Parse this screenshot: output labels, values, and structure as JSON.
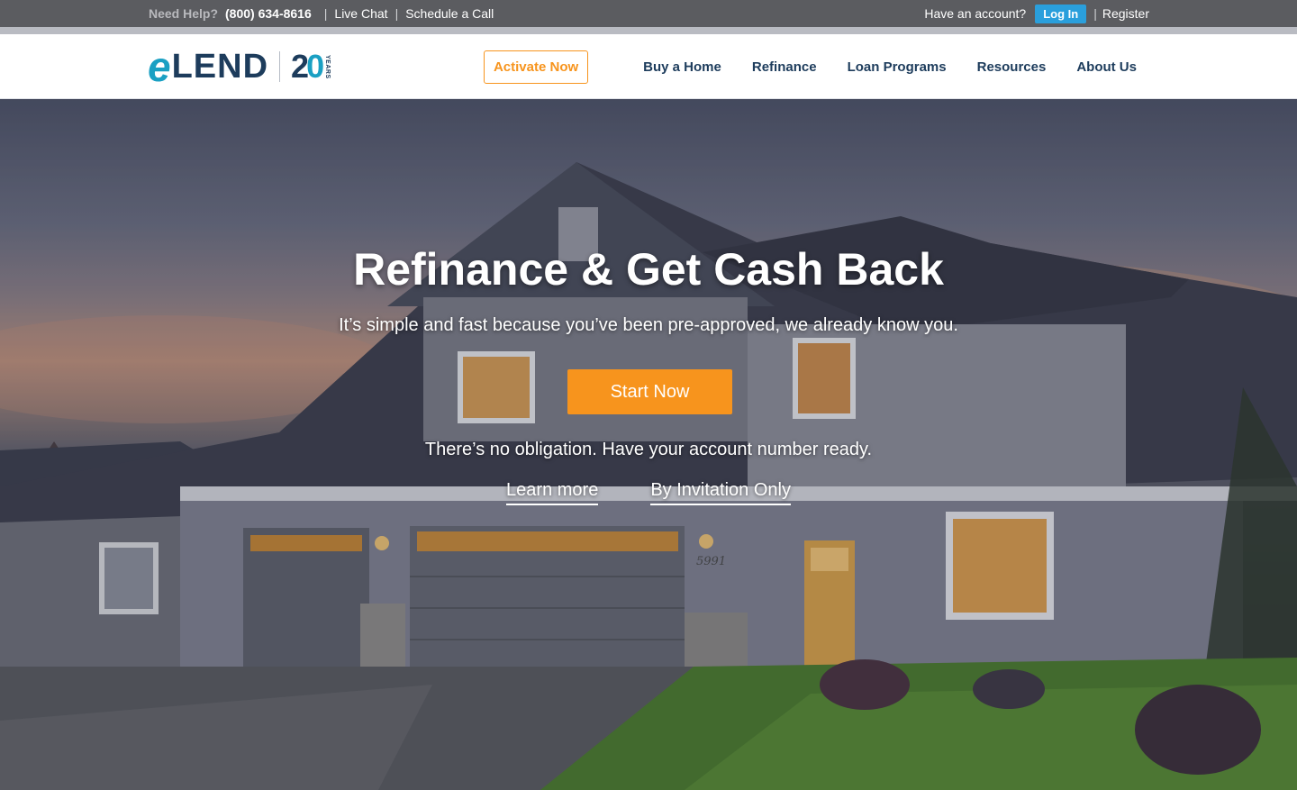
{
  "utility_bar": {
    "help_label": "Need Help?",
    "phone": "(800) 634-8616",
    "separator": "|",
    "live_chat": "Live Chat",
    "schedule_call": "Schedule a Call",
    "account_prompt": "Have an account?",
    "login_label": "Log In",
    "register_label": "Register"
  },
  "logo": {
    "e": "e",
    "lend": "LEND",
    "two": "2",
    "zero": "0",
    "years": "YEARS"
  },
  "nav": {
    "activate_label": "Activate Now",
    "items": [
      "Buy a Home",
      "Refinance",
      "Loan Programs",
      "Resources",
      "About Us"
    ]
  },
  "hero": {
    "title": "Refinance & Get Cash Back",
    "subtitle": "It’s simple and fast because you’ve been pre-approved, we already know you.",
    "cta_label": "Start Now",
    "note": "There’s no obligation. Have your account number ready.",
    "links": [
      "Learn more",
      "By Invitation Only"
    ],
    "house_number": "5991"
  },
  "colors": {
    "accent_orange": "#f7941d",
    "login_blue": "#2a9fdc",
    "navy": "#1d3c5c",
    "teal": "#1aa0c3"
  }
}
